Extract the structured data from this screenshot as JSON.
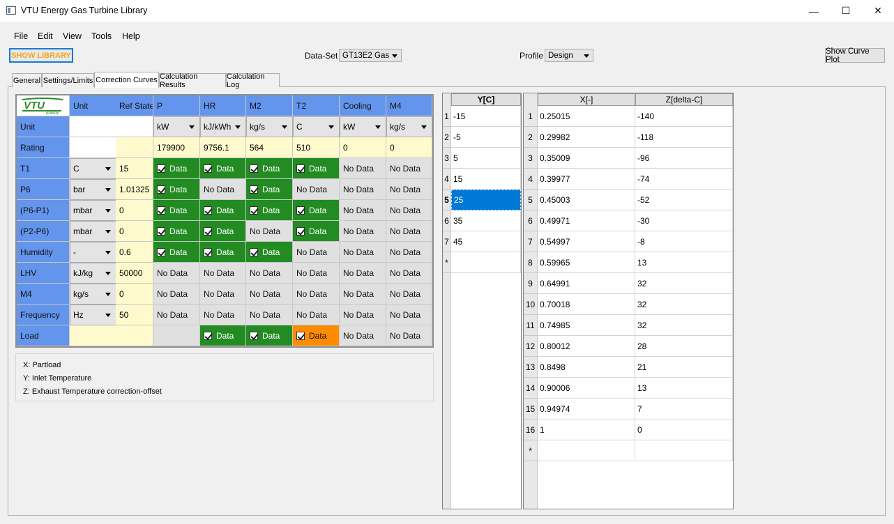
{
  "window": {
    "title": "VTU Energy Gas Turbine Library",
    "minimize_glyph": "—",
    "maximize_glyph": "☐",
    "close_glyph": "✕"
  },
  "menu": [
    "File",
    "Edit",
    "View",
    "Tools",
    "Help"
  ],
  "toolbar": {
    "show_library": "SHOW LIBRARY",
    "dataset_label": "Data-Set",
    "dataset_value": "GT13E2  Gas",
    "profile_label": "Profile",
    "profile_value": "Design",
    "show_curve_plot": "Show Curve Plot"
  },
  "tabs": [
    "General",
    "Settings/Limits",
    "Correction Curves",
    "Calculation Results",
    "Calculation Log"
  ],
  "active_tab": "Correction Curves",
  "logo_text": {
    "main": "VTU",
    "sub": "energy"
  },
  "grid": {
    "headers": [
      "Unit",
      "Ref State",
      "P",
      "HR",
      "M2",
      "T2",
      "Cooling",
      "M4"
    ],
    "unit_row": {
      "label": "Unit",
      "units": [
        "kW",
        "kJ/kWh",
        "kg/s",
        "C",
        "kW",
        "kg/s"
      ]
    },
    "rating_row": {
      "label": "Rating",
      "values": [
        "179900",
        "9756.1",
        "564",
        "510",
        "0",
        "0"
      ]
    },
    "rows": [
      {
        "label": "T1",
        "unit": "C",
        "ref": "15",
        "cells": [
          {
            "t": "Data",
            "s": "green"
          },
          {
            "t": "Data",
            "s": "green"
          },
          {
            "t": "Data",
            "s": "green"
          },
          {
            "t": "Data",
            "s": "green"
          },
          {
            "t": "No Data",
            "s": "gray"
          },
          {
            "t": "No Data",
            "s": "gray"
          }
        ]
      },
      {
        "label": "P6",
        "unit": "bar",
        "ref": "1.01325",
        "cells": [
          {
            "t": "Data",
            "s": "green"
          },
          {
            "t": "No Data",
            "s": "gray"
          },
          {
            "t": "Data",
            "s": "green"
          },
          {
            "t": "No Data",
            "s": "gray"
          },
          {
            "t": "No Data",
            "s": "gray"
          },
          {
            "t": "No Data",
            "s": "gray"
          }
        ]
      },
      {
        "label": "(P6-P1)",
        "unit": "mbar",
        "ref": "0",
        "cells": [
          {
            "t": "Data",
            "s": "green"
          },
          {
            "t": "Data",
            "s": "green"
          },
          {
            "t": "Data",
            "s": "green"
          },
          {
            "t": "Data",
            "s": "green"
          },
          {
            "t": "No Data",
            "s": "gray"
          },
          {
            "t": "No Data",
            "s": "gray"
          }
        ]
      },
      {
        "label": "(P2-P6)",
        "unit": "mbar",
        "ref": "0",
        "cells": [
          {
            "t": "Data",
            "s": "green"
          },
          {
            "t": "Data",
            "s": "green"
          },
          {
            "t": "No Data",
            "s": "gray"
          },
          {
            "t": "Data",
            "s": "green"
          },
          {
            "t": "No Data",
            "s": "gray"
          },
          {
            "t": "No Data",
            "s": "gray"
          }
        ]
      },
      {
        "label": "Humidity",
        "unit": "-",
        "ref": "0.6",
        "cells": [
          {
            "t": "Data",
            "s": "green"
          },
          {
            "t": "Data",
            "s": "green"
          },
          {
            "t": "Data",
            "s": "green"
          },
          {
            "t": "No Data",
            "s": "gray"
          },
          {
            "t": "No Data",
            "s": "gray"
          },
          {
            "t": "No Data",
            "s": "gray"
          }
        ]
      },
      {
        "label": "LHV",
        "unit": "kJ/kg",
        "ref": "50000",
        "cells": [
          {
            "t": "No Data",
            "s": "gray"
          },
          {
            "t": "No Data",
            "s": "gray"
          },
          {
            "t": "No Data",
            "s": "gray"
          },
          {
            "t": "No Data",
            "s": "gray"
          },
          {
            "t": "No Data",
            "s": "gray"
          },
          {
            "t": "No Data",
            "s": "gray"
          }
        ]
      },
      {
        "label": "M4",
        "unit": "kg/s",
        "ref": "0",
        "cells": [
          {
            "t": "No Data",
            "s": "gray"
          },
          {
            "t": "No Data",
            "s": "gray"
          },
          {
            "t": "No Data",
            "s": "gray"
          },
          {
            "t": "No Data",
            "s": "gray"
          },
          {
            "t": "No Data",
            "s": "gray"
          },
          {
            "t": "No Data",
            "s": "gray"
          }
        ]
      },
      {
        "label": "Frequency",
        "unit": "Hz",
        "ref": "50",
        "cells": [
          {
            "t": "No Data",
            "s": "gray"
          },
          {
            "t": "No Data",
            "s": "gray"
          },
          {
            "t": "No Data",
            "s": "gray"
          },
          {
            "t": "No Data",
            "s": "gray"
          },
          {
            "t": "No Data",
            "s": "gray"
          },
          {
            "t": "No Data",
            "s": "gray"
          }
        ]
      },
      {
        "label": "Load",
        "unit": "",
        "ref": "",
        "cells": [
          {
            "t": "",
            "s": "gray"
          },
          {
            "t": "Data",
            "s": "green"
          },
          {
            "t": "Data",
            "s": "green"
          },
          {
            "t": "Data",
            "s": "orange"
          },
          {
            "t": "No Data",
            "s": "gray"
          },
          {
            "t": "No Data",
            "s": "gray"
          }
        ]
      }
    ]
  },
  "legend": [
    "X:  Partload",
    "Y:  Inlet Temperature",
    "Z:  Exhaust Temperature correction-offset"
  ],
  "y_table": {
    "header": "Y[C]",
    "rows": [
      "-15",
      "-5",
      "5",
      "15",
      "25",
      "35",
      "45"
    ],
    "selected_row": 5,
    "new_row_marker": "*"
  },
  "xz_table": {
    "headers": [
      "X[-]",
      "Z[delta-C]"
    ],
    "rows": [
      [
        "0.25015",
        "-140"
      ],
      [
        "0.29982",
        "-118"
      ],
      [
        "0.35009",
        "-96"
      ],
      [
        "0.39977",
        "-74"
      ],
      [
        "0.45003",
        "-52"
      ],
      [
        "0.49971",
        "-30"
      ],
      [
        "0.54997",
        "-8"
      ],
      [
        "0.59965",
        "13"
      ],
      [
        "0.64991",
        "32"
      ],
      [
        "0.70018",
        "32"
      ],
      [
        "0.74985",
        "32"
      ],
      [
        "0.80012",
        "28"
      ],
      [
        "0.8498",
        "21"
      ],
      [
        "0.90006",
        "13"
      ],
      [
        "0.94974",
        "7"
      ],
      [
        "1",
        "0"
      ]
    ],
    "new_row_marker": "*"
  },
  "colors": {
    "header_blue": "#6495ed",
    "data_green": "#228b22",
    "data_orange": "#ff8c00",
    "ref_cream": "#fffacd",
    "selection_blue": "#0078d7",
    "show_library_text": "#f5a623"
  }
}
